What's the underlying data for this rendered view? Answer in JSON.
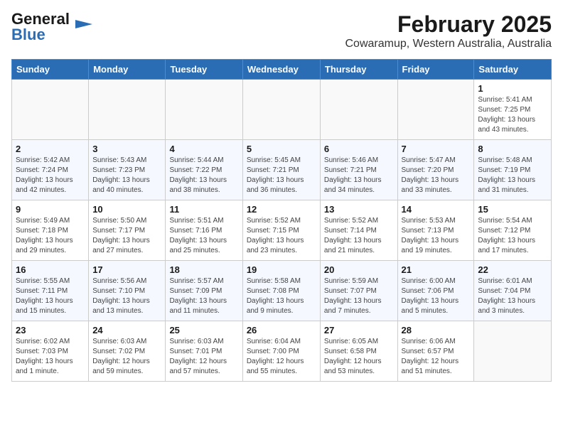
{
  "header": {
    "logo_general": "General",
    "logo_blue": "Blue",
    "title": "February 2025",
    "subtitle": "Cowaramup, Western Australia, Australia"
  },
  "calendar": {
    "weekdays": [
      "Sunday",
      "Monday",
      "Tuesday",
      "Wednesday",
      "Thursday",
      "Friday",
      "Saturday"
    ],
    "weeks": [
      [
        {
          "day": "",
          "info": ""
        },
        {
          "day": "",
          "info": ""
        },
        {
          "day": "",
          "info": ""
        },
        {
          "day": "",
          "info": ""
        },
        {
          "day": "",
          "info": ""
        },
        {
          "day": "",
          "info": ""
        },
        {
          "day": "1",
          "info": "Sunrise: 5:41 AM\nSunset: 7:25 PM\nDaylight: 13 hours\nand 43 minutes."
        }
      ],
      [
        {
          "day": "2",
          "info": "Sunrise: 5:42 AM\nSunset: 7:24 PM\nDaylight: 13 hours\nand 42 minutes."
        },
        {
          "day": "3",
          "info": "Sunrise: 5:43 AM\nSunset: 7:23 PM\nDaylight: 13 hours\nand 40 minutes."
        },
        {
          "day": "4",
          "info": "Sunrise: 5:44 AM\nSunset: 7:22 PM\nDaylight: 13 hours\nand 38 minutes."
        },
        {
          "day": "5",
          "info": "Sunrise: 5:45 AM\nSunset: 7:21 PM\nDaylight: 13 hours\nand 36 minutes."
        },
        {
          "day": "6",
          "info": "Sunrise: 5:46 AM\nSunset: 7:21 PM\nDaylight: 13 hours\nand 34 minutes."
        },
        {
          "day": "7",
          "info": "Sunrise: 5:47 AM\nSunset: 7:20 PM\nDaylight: 13 hours\nand 33 minutes."
        },
        {
          "day": "8",
          "info": "Sunrise: 5:48 AM\nSunset: 7:19 PM\nDaylight: 13 hours\nand 31 minutes."
        }
      ],
      [
        {
          "day": "9",
          "info": "Sunrise: 5:49 AM\nSunset: 7:18 PM\nDaylight: 13 hours\nand 29 minutes."
        },
        {
          "day": "10",
          "info": "Sunrise: 5:50 AM\nSunset: 7:17 PM\nDaylight: 13 hours\nand 27 minutes."
        },
        {
          "day": "11",
          "info": "Sunrise: 5:51 AM\nSunset: 7:16 PM\nDaylight: 13 hours\nand 25 minutes."
        },
        {
          "day": "12",
          "info": "Sunrise: 5:52 AM\nSunset: 7:15 PM\nDaylight: 13 hours\nand 23 minutes."
        },
        {
          "day": "13",
          "info": "Sunrise: 5:52 AM\nSunset: 7:14 PM\nDaylight: 13 hours\nand 21 minutes."
        },
        {
          "day": "14",
          "info": "Sunrise: 5:53 AM\nSunset: 7:13 PM\nDaylight: 13 hours\nand 19 minutes."
        },
        {
          "day": "15",
          "info": "Sunrise: 5:54 AM\nSunset: 7:12 PM\nDaylight: 13 hours\nand 17 minutes."
        }
      ],
      [
        {
          "day": "16",
          "info": "Sunrise: 5:55 AM\nSunset: 7:11 PM\nDaylight: 13 hours\nand 15 minutes."
        },
        {
          "day": "17",
          "info": "Sunrise: 5:56 AM\nSunset: 7:10 PM\nDaylight: 13 hours\nand 13 minutes."
        },
        {
          "day": "18",
          "info": "Sunrise: 5:57 AM\nSunset: 7:09 PM\nDaylight: 13 hours\nand 11 minutes."
        },
        {
          "day": "19",
          "info": "Sunrise: 5:58 AM\nSunset: 7:08 PM\nDaylight: 13 hours\nand 9 minutes."
        },
        {
          "day": "20",
          "info": "Sunrise: 5:59 AM\nSunset: 7:07 PM\nDaylight: 13 hours\nand 7 minutes."
        },
        {
          "day": "21",
          "info": "Sunrise: 6:00 AM\nSunset: 7:06 PM\nDaylight: 13 hours\nand 5 minutes."
        },
        {
          "day": "22",
          "info": "Sunrise: 6:01 AM\nSunset: 7:04 PM\nDaylight: 13 hours\nand 3 minutes."
        }
      ],
      [
        {
          "day": "23",
          "info": "Sunrise: 6:02 AM\nSunset: 7:03 PM\nDaylight: 13 hours\nand 1 minute."
        },
        {
          "day": "24",
          "info": "Sunrise: 6:03 AM\nSunset: 7:02 PM\nDaylight: 12 hours\nand 59 minutes."
        },
        {
          "day": "25",
          "info": "Sunrise: 6:03 AM\nSunset: 7:01 PM\nDaylight: 12 hours\nand 57 minutes."
        },
        {
          "day": "26",
          "info": "Sunrise: 6:04 AM\nSunset: 7:00 PM\nDaylight: 12 hours\nand 55 minutes."
        },
        {
          "day": "27",
          "info": "Sunrise: 6:05 AM\nSunset: 6:58 PM\nDaylight: 12 hours\nand 53 minutes."
        },
        {
          "day": "28",
          "info": "Sunrise: 6:06 AM\nSunset: 6:57 PM\nDaylight: 12 hours\nand 51 minutes."
        },
        {
          "day": "",
          "info": ""
        }
      ]
    ]
  }
}
